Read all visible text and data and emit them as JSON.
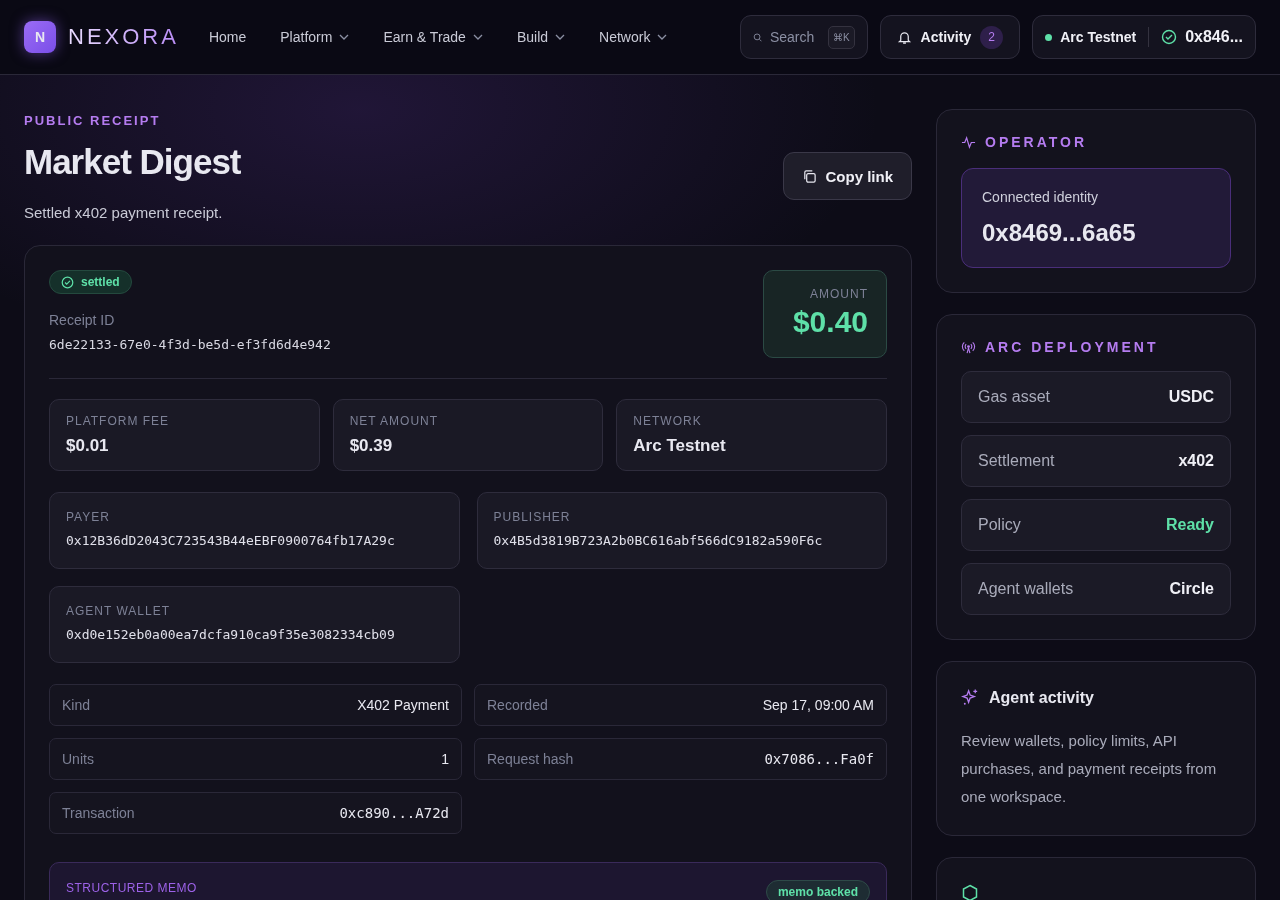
{
  "brand": {
    "badge": "N",
    "name": "NEXORA"
  },
  "nav": [
    {
      "label": "Home",
      "dropdown": false
    },
    {
      "label": "Platform",
      "dropdown": true
    },
    {
      "label": "Earn & Trade",
      "dropdown": true
    },
    {
      "label": "Build",
      "dropdown": true
    },
    {
      "label": "Network",
      "dropdown": true
    }
  ],
  "search": {
    "placeholder": "Search",
    "shortcut": "⌘K"
  },
  "activity": {
    "label": "Activity",
    "count": "2"
  },
  "wallet": {
    "network": "Arc Testnet",
    "address": "0x846..."
  },
  "header": {
    "eyebrow": "PUBLIC RECEIPT",
    "title": "Market Digest",
    "subtitle": "Settled x402 payment receipt.",
    "copy_button": "Copy link"
  },
  "receipt": {
    "status": "settled",
    "id_label": "Receipt ID",
    "id": "6de22133-67e0-4f3d-be5d-ef3fd6d4e942",
    "amount_label": "AMOUNT",
    "amount": "$0.40",
    "stats": [
      {
        "label": "PLATFORM FEE",
        "value": "$0.01"
      },
      {
        "label": "NET AMOUNT",
        "value": "$0.39"
      },
      {
        "label": "NETWORK",
        "value": "Arc Testnet"
      }
    ],
    "addresses": [
      {
        "label": "PAYER",
        "value": "0x12B36dD2043C723543B44eEBF0900764fb17A29c"
      },
      {
        "label": "PUBLISHER",
        "value": "0x4B5d3819B723A2b0BC616abf566dC9182a590F6c"
      },
      {
        "label": "AGENT WALLET",
        "value": "0xd0e152eb0a00ea7dcfa910ca9f35e3082334cb09"
      }
    ],
    "details_left": [
      {
        "label": "Kind",
        "value": "X402 Payment",
        "kind": "text"
      },
      {
        "label": "Units",
        "value": "1",
        "kind": "text"
      },
      {
        "label": "Transaction",
        "value": "0xc890...A72d",
        "kind": "hash"
      }
    ],
    "details_right": [
      {
        "label": "Recorded",
        "value": "Sep 17, 09:00 AM",
        "kind": "text"
      },
      {
        "label": "Request hash",
        "value": "0x7086...Fa0f",
        "kind": "hash"
      }
    ],
    "memo": {
      "label": "STRUCTURED MEMO",
      "badge": "memo backed"
    }
  },
  "operator": {
    "title": "OPERATOR",
    "identity_label": "Connected identity",
    "identity": "0x8469...6a65"
  },
  "deployment": {
    "title": "ARC DEPLOYMENT",
    "rows": [
      {
        "label": "Gas asset",
        "value": "USDC",
        "kind": "plain"
      },
      {
        "label": "Settlement",
        "value": "x402",
        "kind": "plain"
      },
      {
        "label": "Policy",
        "value": "Ready",
        "kind": "status"
      },
      {
        "label": "Agent wallets",
        "value": "Circle",
        "kind": "plain"
      }
    ]
  },
  "agent_activity": {
    "title": "Agent activity",
    "text": "Review wallets, policy limits, API purchases, and payment receipts from one workspace."
  }
}
